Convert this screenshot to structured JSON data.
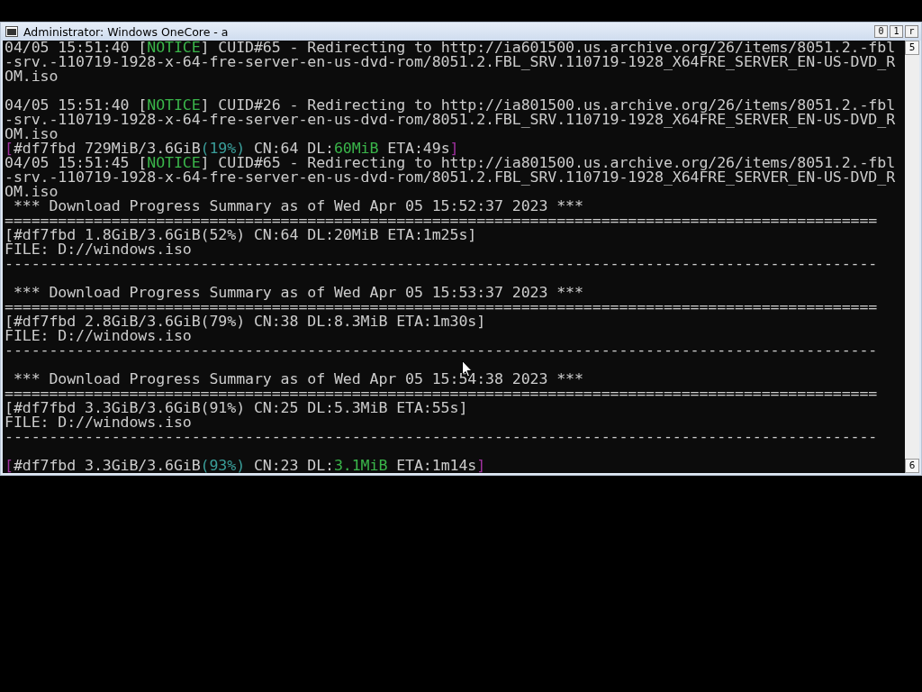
{
  "window": {
    "title": "Administrator:  Windows OneCore - a",
    "buttons": [
      "0",
      "1",
      "r"
    ]
  },
  "scrollbar": {
    "up": "5",
    "down": "6"
  },
  "console": [
    {
      "kind": "text",
      "segments": [
        {
          "kind": "plain",
          "text": "04/05 15:51:40 ["
        },
        {
          "kind": "notice",
          "text": "NOTICE"
        },
        {
          "kind": "plain",
          "text": "] CUID#65 - Redirecting to http://ia601500.us.archive.org/26/items/8051.2.-fbl"
        }
      ]
    },
    {
      "kind": "text",
      "segments": [
        {
          "kind": "plain",
          "text": "-srv.-110719-1928-x-64-fre-server-en-us-dvd-rom/8051.2.FBL_SRV.110719-1928_X64FRE_SERVER_EN-US-DVD_R"
        }
      ]
    },
    {
      "kind": "text",
      "segments": [
        {
          "kind": "plain",
          "text": "OM.iso"
        }
      ]
    },
    {
      "kind": "blank"
    },
    {
      "kind": "text",
      "segments": [
        {
          "kind": "plain",
          "text": "04/05 15:51:40 ["
        },
        {
          "kind": "notice",
          "text": "NOTICE"
        },
        {
          "kind": "plain",
          "text": "] CUID#26 - Redirecting to http://ia801500.us.archive.org/26/items/8051.2.-fbl"
        }
      ]
    },
    {
      "kind": "text",
      "segments": [
        {
          "kind": "plain",
          "text": "-srv.-110719-1928-x-64-fre-server-en-us-dvd-rom/8051.2.FBL_SRV.110719-1928_X64FRE_SERVER_EN-US-DVD_R"
        }
      ]
    },
    {
      "kind": "text",
      "segments": [
        {
          "kind": "plain",
          "text": "OM.iso"
        }
      ]
    },
    {
      "kind": "text",
      "segments": [
        {
          "kind": "bracket",
          "text": "["
        },
        {
          "kind": "plain",
          "text": "#df7fbd 729MiB/3.6GiB"
        },
        {
          "kind": "percent",
          "text": "(19%)"
        },
        {
          "kind": "plain",
          "text": " CN:64 DL:"
        },
        {
          "kind": "speed",
          "text": "60MiB"
        },
        {
          "kind": "plain",
          "text": " ETA:49s"
        },
        {
          "kind": "bracket",
          "text": "]"
        }
      ]
    },
    {
      "kind": "text",
      "segments": [
        {
          "kind": "plain",
          "text": "04/05 15:51:45 ["
        },
        {
          "kind": "notice",
          "text": "NOTICE"
        },
        {
          "kind": "plain",
          "text": "] CUID#65 - Redirecting to http://ia801500.us.archive.org/26/items/8051.2.-fbl"
        }
      ]
    },
    {
      "kind": "text",
      "segments": [
        {
          "kind": "plain",
          "text": "-srv.-110719-1928-x-64-fre-server-en-us-dvd-rom/8051.2.FBL_SRV.110719-1928_X64FRE_SERVER_EN-US-DVD_R"
        }
      ]
    },
    {
      "kind": "text",
      "segments": [
        {
          "kind": "plain",
          "text": "OM.iso"
        }
      ]
    },
    {
      "kind": "text",
      "segments": [
        {
          "kind": "plain",
          "text": " *** Download Progress Summary as of Wed Apr 05 15:52:37 2023 ***"
        }
      ]
    },
    {
      "kind": "text",
      "segments": [
        {
          "kind": "plain",
          "text": "=================================================================================================="
        }
      ]
    },
    {
      "kind": "text",
      "segments": [
        {
          "kind": "plain",
          "text": "[#df7fbd 1.8GiB/3.6GiB(52%) CN:64 DL:20MiB ETA:1m25s]"
        }
      ]
    },
    {
      "kind": "text",
      "segments": [
        {
          "kind": "plain",
          "text": "FILE: D://windows.iso"
        }
      ]
    },
    {
      "kind": "text",
      "segments": [
        {
          "kind": "plain",
          "text": "--------------------------------------------------------------------------------------------------"
        }
      ]
    },
    {
      "kind": "blank"
    },
    {
      "kind": "text",
      "segments": [
        {
          "kind": "plain",
          "text": " *** Download Progress Summary as of Wed Apr 05 15:53:37 2023 ***"
        }
      ]
    },
    {
      "kind": "text",
      "segments": [
        {
          "kind": "plain",
          "text": "=================================================================================================="
        }
      ]
    },
    {
      "kind": "text",
      "segments": [
        {
          "kind": "plain",
          "text": "[#df7fbd 2.8GiB/3.6GiB(79%) CN:38 DL:8.3MiB ETA:1m30s]"
        }
      ]
    },
    {
      "kind": "text",
      "segments": [
        {
          "kind": "plain",
          "text": "FILE: D://windows.iso"
        }
      ]
    },
    {
      "kind": "text",
      "segments": [
        {
          "kind": "plain",
          "text": "--------------------------------------------------------------------------------------------------"
        }
      ]
    },
    {
      "kind": "blank"
    },
    {
      "kind": "text",
      "segments": [
        {
          "kind": "plain",
          "text": " *** Download Progress Summary as of Wed Apr 05 15:54:38 2023 ***"
        }
      ]
    },
    {
      "kind": "text",
      "segments": [
        {
          "kind": "plain",
          "text": "=================================================================================================="
        }
      ]
    },
    {
      "kind": "text",
      "segments": [
        {
          "kind": "plain",
          "text": "[#df7fbd 3.3GiB/3.6GiB(91%) CN:25 DL:5.3MiB ETA:55s]"
        }
      ]
    },
    {
      "kind": "text",
      "segments": [
        {
          "kind": "plain",
          "text": "FILE: D://windows.iso"
        }
      ]
    },
    {
      "kind": "text",
      "segments": [
        {
          "kind": "plain",
          "text": "--------------------------------------------------------------------------------------------------"
        }
      ]
    },
    {
      "kind": "blank"
    },
    {
      "kind": "text",
      "segments": [
        {
          "kind": "bracket",
          "text": "["
        },
        {
          "kind": "plain",
          "text": "#df7fbd 3.3GiB/3.6GiB"
        },
        {
          "kind": "percent",
          "text": "(93%)"
        },
        {
          "kind": "plain",
          "text": " CN:23 DL:"
        },
        {
          "kind": "speed",
          "text": "3.1MiB"
        },
        {
          "kind": "plain",
          "text": " ETA:1m14s"
        },
        {
          "kind": "bracket",
          "text": "]"
        }
      ]
    }
  ]
}
